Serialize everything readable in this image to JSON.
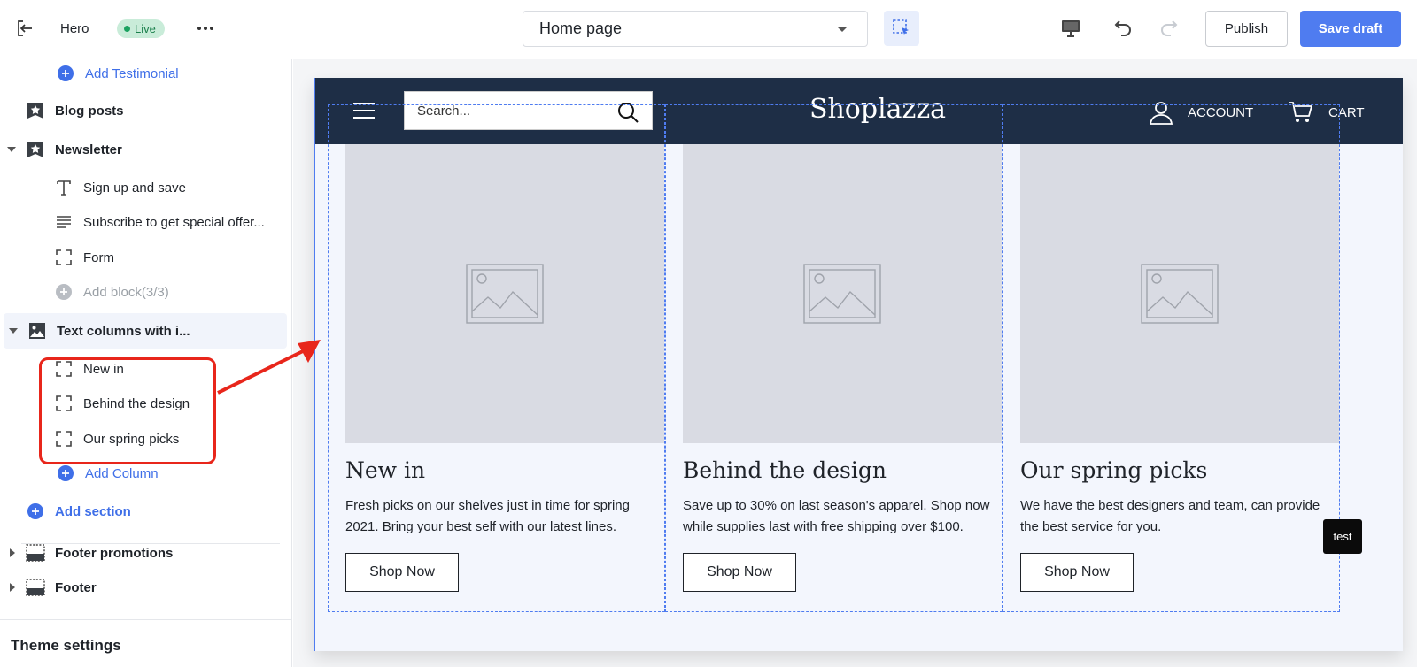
{
  "topbar": {
    "theme_name": "Hero",
    "status_badge": "Live",
    "page_selector": "Home page",
    "publish_label": "Publish",
    "save_draft_label": "Save draft"
  },
  "sidebar": {
    "add_testimonial": "Add Testimonial",
    "blog_posts": "Blog posts",
    "newsletter": "Newsletter",
    "newsletter_blocks": [
      "Sign up and save",
      "Subscribe to get special offer...",
      "Form"
    ],
    "add_block": "Add block(3/3)",
    "text_columns": "Text columns with i...",
    "columns": [
      "New in",
      "Behind the design",
      "Our spring picks"
    ],
    "add_column": "Add Column",
    "add_section": "Add section",
    "footer_promotions": "Footer promotions",
    "footer": "Footer",
    "theme_settings": "Theme settings"
  },
  "store": {
    "search_placeholder": "Search...",
    "logo": "Shoplazza",
    "account": "ACCOUNT",
    "cart": "CART",
    "columns": [
      {
        "title": "New in",
        "text": "Fresh picks on our shelves just in time for spring 2021. Bring your best self with our latest lines.",
        "button": "Shop Now"
      },
      {
        "title": "Behind the design",
        "text": "Save up to 30% on last season's apparel. Shop now while supplies last with free shipping over $100.",
        "button": "Shop Now"
      },
      {
        "title": "Our spring picks",
        "text": "We have the best designers and team, can provide the best service for you.",
        "button": "Shop Now"
      }
    ],
    "test_tag": "test"
  },
  "colors": {
    "accent": "#4f7cf0",
    "store_header": "#1e2e46",
    "annotation": "#e8261b",
    "live_badge_bg": "#c9ecd9"
  }
}
